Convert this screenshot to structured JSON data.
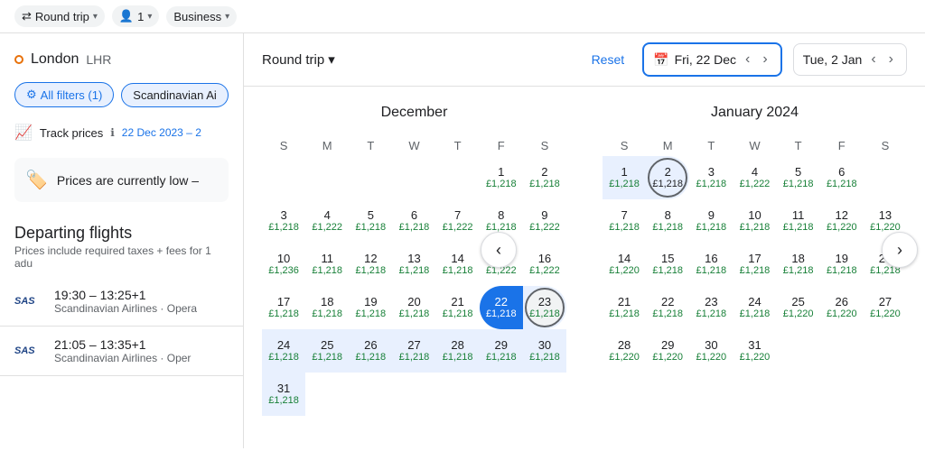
{
  "topbar": {
    "trip_type": "Round trip",
    "passengers": "1",
    "class": "Business",
    "chevron": "▾"
  },
  "sidebar": {
    "origin": "London",
    "origin_code": "LHR",
    "all_filters_label": "All filters (1)",
    "airline_filter": "Scandinavian Ai",
    "track_prices_label": "Track prices",
    "track_date_range": "22 Dec 2023 – 2",
    "prices_low_text": "Prices are currently low –",
    "departing_title": "Departing flights",
    "departing_subtitle": "Prices include required taxes + fees for 1 adu",
    "flights": [
      {
        "airline_logo": "SAS",
        "time": "19:30 – 13:25+1",
        "airline_name": "Scandinavian Airlines · Opera"
      },
      {
        "airline_logo": "SAS",
        "time": "21:05 – 13:35+1",
        "airline_name": "Scandinavian Airlines · Oper"
      }
    ]
  },
  "cal_header": {
    "trip_label": "Round trip",
    "reset_label": "Reset",
    "depart_date": "Fri, 22 Dec",
    "return_date": "Tue, 2 Jan",
    "calendar_icon": "📅"
  },
  "december": {
    "title": "December",
    "days_header": [
      "S",
      "M",
      "T",
      "W",
      "T",
      "F",
      "S"
    ],
    "weeks": [
      [
        null,
        null,
        null,
        null,
        null,
        {
          "n": "1",
          "p": "£1,218"
        },
        {
          "n": "2",
          "p": "£1,218"
        }
      ],
      [
        {
          "n": "3",
          "p": "£1,218"
        },
        {
          "n": "4",
          "p": "£1,222"
        },
        {
          "n": "5",
          "p": "£1,218"
        },
        {
          "n": "6",
          "p": "£1,218"
        },
        {
          "n": "7",
          "p": "£1,222"
        },
        {
          "n": "8",
          "p": "£1,218"
        },
        {
          "n": "9",
          "p": "£1,222"
        }
      ],
      [
        {
          "n": "10",
          "p": "£1,236"
        },
        {
          "n": "11",
          "p": "£1,218"
        },
        {
          "n": "12",
          "p": "£1,218"
        },
        {
          "n": "13",
          "p": "£1,218"
        },
        {
          "n": "14",
          "p": "£1,218"
        },
        {
          "n": "15",
          "p": "£1,222"
        },
        {
          "n": "16",
          "p": "£1,222"
        }
      ],
      [
        {
          "n": "17",
          "p": "£1,218"
        },
        {
          "n": "18",
          "p": "£1,218"
        },
        {
          "n": "19",
          "p": "£1,218"
        },
        {
          "n": "20",
          "p": "£1,218"
        },
        {
          "n": "21",
          "p": "£1,218"
        },
        {
          "n": "22",
          "p": "£1,218",
          "selected": true
        },
        {
          "n": "23",
          "p": "£1,218",
          "in_range_end": true
        }
      ],
      [
        {
          "n": "24",
          "p": "£1,218",
          "in_range": true
        },
        {
          "n": "25",
          "p": "£1,218",
          "in_range": true
        },
        {
          "n": "26",
          "p": "£1,218",
          "in_range": true
        },
        {
          "n": "27",
          "p": "£1,218",
          "in_range": true
        },
        {
          "n": "28",
          "p": "£1,218",
          "in_range": true
        },
        {
          "n": "29",
          "p": "£1,218",
          "in_range": true
        },
        {
          "n": "30",
          "p": "£1,218",
          "in_range": true
        }
      ],
      [
        {
          "n": "31",
          "p": "£1,218",
          "in_range": true
        },
        null,
        null,
        null,
        null,
        null,
        null
      ]
    ]
  },
  "january": {
    "title": "January 2024",
    "days_header": [
      "S",
      "M",
      "T",
      "W",
      "T",
      "F",
      "S"
    ],
    "weeks": [
      [
        {
          "n": "1",
          "p": "£1,218",
          "in_range": true
        },
        {
          "n": "2",
          "p": "£1,218",
          "today": true
        },
        {
          "n": "3",
          "p": "£1,218"
        },
        {
          "n": "4",
          "p": "£1,222"
        },
        {
          "n": "5",
          "p": "£1,218"
        },
        {
          "n": "6",
          "p": "£1,218"
        }
      ],
      [
        {
          "n": "7",
          "p": "£1,218"
        },
        {
          "n": "8",
          "p": "£1,218"
        },
        {
          "n": "9",
          "p": "£1,218"
        },
        {
          "n": "10",
          "p": "£1,218"
        },
        {
          "n": "11",
          "p": "£1,218"
        },
        {
          "n": "12",
          "p": "£1,220"
        },
        {
          "n": "13",
          "p": "£1,220"
        }
      ],
      [
        {
          "n": "14",
          "p": "£1,220"
        },
        {
          "n": "15",
          "p": "£1,218"
        },
        {
          "n": "16",
          "p": "£1,218"
        },
        {
          "n": "17",
          "p": "£1,218"
        },
        {
          "n": "18",
          "p": "£1,218"
        },
        {
          "n": "19",
          "p": "£1,218"
        },
        {
          "n": "20",
          "p": "£1,218"
        }
      ],
      [
        {
          "n": "21",
          "p": "£1,218"
        },
        {
          "n": "22",
          "p": "£1,218"
        },
        {
          "n": "23",
          "p": "£1,218"
        },
        {
          "n": "24",
          "p": "£1,218"
        },
        {
          "n": "25",
          "p": "£1,220"
        },
        {
          "n": "26",
          "p": "£1,220"
        },
        {
          "n": "27",
          "p": "£1,220"
        }
      ],
      [
        {
          "n": "28",
          "p": "£1,220"
        },
        {
          "n": "29",
          "p": "£1,220"
        },
        {
          "n": "30",
          "p": "£1,220"
        },
        {
          "n": "31",
          "p": "£1,220"
        },
        null,
        null,
        null
      ]
    ]
  },
  "nav": {
    "prev": "‹",
    "next": "›"
  }
}
